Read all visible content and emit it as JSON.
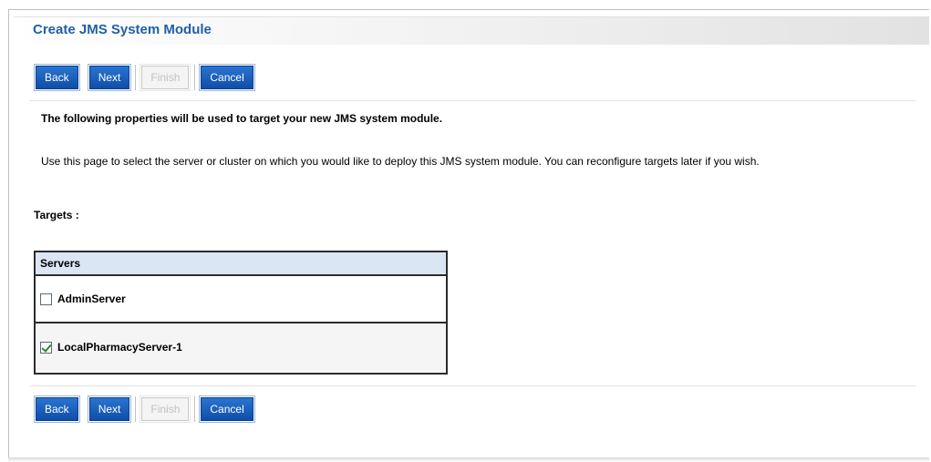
{
  "page": {
    "title": "Create JMS System Module",
    "intro": "The following properties will be used to target your new JMS system module.",
    "description": "Use this page to select the server or cluster on which you would like to deploy this JMS system module. You can reconfigure targets later if you wish.",
    "targets_label": "Targets :"
  },
  "toolbar": {
    "back_label": "Back",
    "next_label": "Next",
    "finish_label": "Finish",
    "cancel_label": "Cancel"
  },
  "servers_table": {
    "header": "Servers",
    "rows": [
      {
        "name": "AdminServer",
        "checked": false
      },
      {
        "name": "LocalPharmacyServer-1",
        "checked": true
      }
    ]
  },
  "colors": {
    "title": "#1f5fa8",
    "button": "#1a5fbf",
    "table_header": "#dbe6f5"
  }
}
